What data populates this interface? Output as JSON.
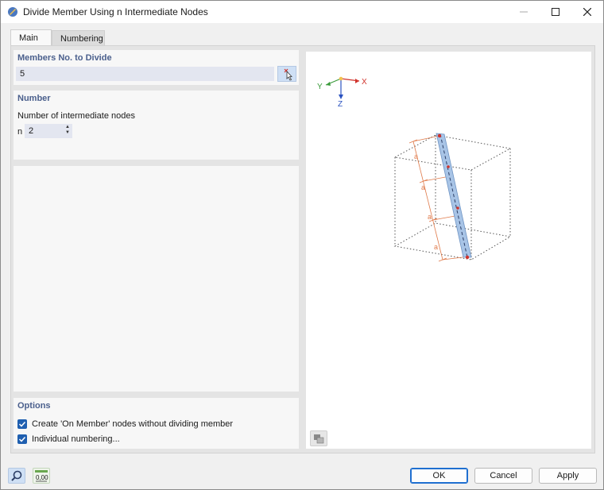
{
  "window": {
    "title": "Divide Member Using n Intermediate Nodes"
  },
  "tabs": [
    {
      "label": "Main",
      "active": true
    },
    {
      "label": "Numbering",
      "active": false
    }
  ],
  "members": {
    "title": "Members No. to Divide",
    "value": "5"
  },
  "number": {
    "title": "Number",
    "field_label": "Number of intermediate nodes",
    "n_symbol": "n",
    "n_value": "2"
  },
  "options": {
    "title": "Options",
    "items": [
      {
        "label": "Create 'On Member' nodes without dividing member",
        "checked": true
      },
      {
        "label": "Individual numbering...",
        "checked": true
      }
    ]
  },
  "preview": {
    "axis_x": "X",
    "axis_y": "Y",
    "axis_z": "Z",
    "dim_label": "a"
  },
  "footer": {
    "ok": "OK",
    "cancel": "Cancel",
    "apply": "Apply"
  },
  "units_icon_text": "0,00",
  "colors": {
    "panel_title": "#4a5f8c",
    "accent": "#1f5fb0",
    "member": "#a8c4e6",
    "dim": "#e07a4a"
  }
}
